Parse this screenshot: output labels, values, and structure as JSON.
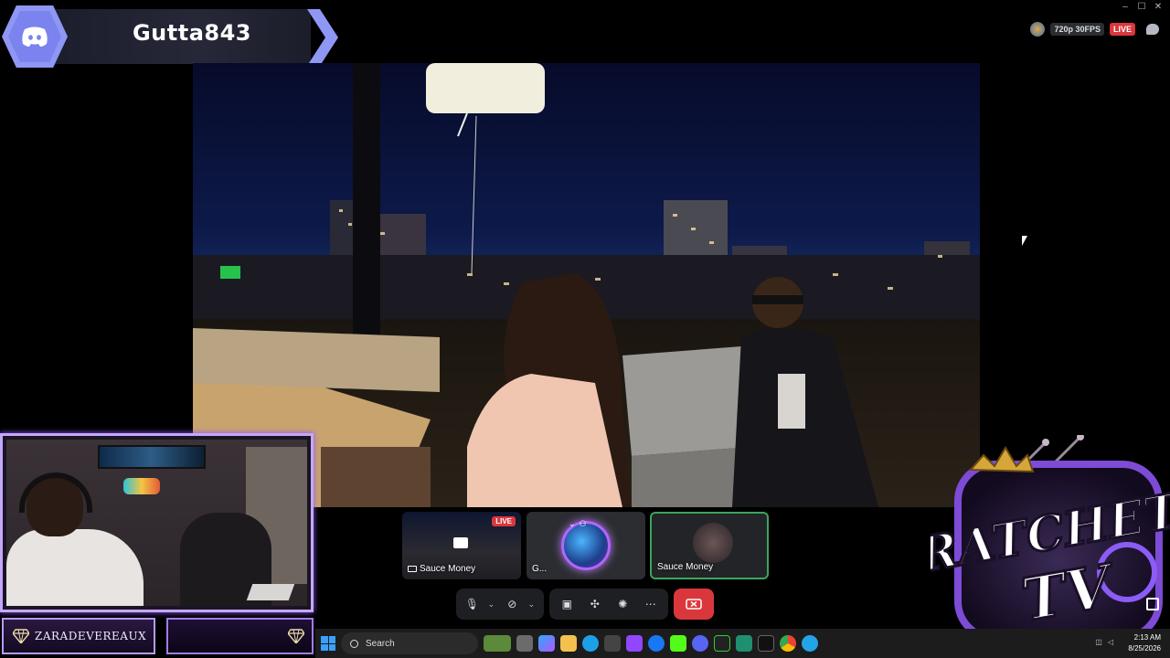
{
  "banner": {
    "username": "Gutta843"
  },
  "status": {
    "quality": "720p 30FPS",
    "live": "LIVE"
  },
  "window_controls": {
    "minimize": "–",
    "maximize": "☐",
    "close": "✕"
  },
  "webcam": {
    "name_plate": "ZARADEVEREAUX"
  },
  "participants": [
    {
      "label": "Sauce Money",
      "badge": "LIVE"
    },
    {
      "label": "G..."
    },
    {
      "label": "Sauce Money"
    }
  ],
  "controls": {
    "mic": "🎙",
    "camera": "⊘",
    "screen": "▣",
    "activities": "✣",
    "soundboard": "✺",
    "more": "⋯",
    "caret": "⌄"
  },
  "logo": {
    "text_top": "RATCHET",
    "text_bottom": "TV"
  },
  "taskbar": {
    "search_placeholder": "Search",
    "time": "2:13 AM",
    "date": "8/25/2026"
  },
  "colors": {
    "discord": "#7b84ee",
    "live": "#da373c",
    "accent_purple": "#b69bff",
    "speaking_green": "#3ba55d"
  }
}
